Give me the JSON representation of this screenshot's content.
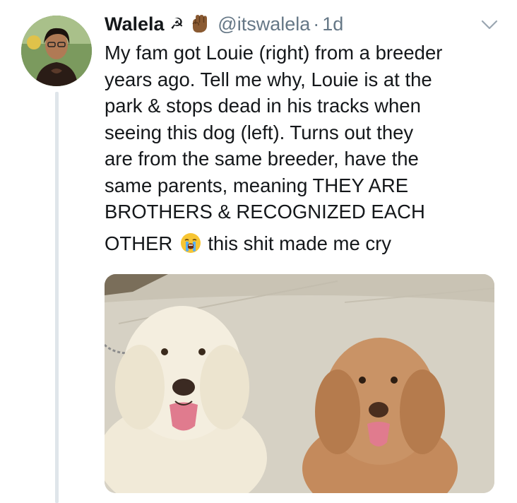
{
  "author": {
    "display_name": "Walela",
    "name_emoji": "☭",
    "name_emoji_icon": "raised-fist-icon",
    "handle": "@itswalela",
    "separator": "·",
    "timestamp": "1d"
  },
  "tweet": {
    "lines": [
      "My fam got Louie (right) from a breeder",
      "years ago. Tell me why, Louie is at the",
      "park & stops dead in his tracks when",
      "seeing this dog (left). Turns out they",
      "are from the same breeder, have the",
      "same parents, meaning THEY ARE",
      "BROTHERS & RECOGNIZED EACH"
    ],
    "last_line_before": "OTHER",
    "last_line_emoji_icon": "loudly-crying-face-icon",
    "last_line_after": "this shit made me cry"
  },
  "media": {
    "icon": "photo-two-dogs"
  },
  "colors": {
    "text": "#14171a",
    "secondary": "#657786",
    "thread_line": "#dfe5ea"
  }
}
